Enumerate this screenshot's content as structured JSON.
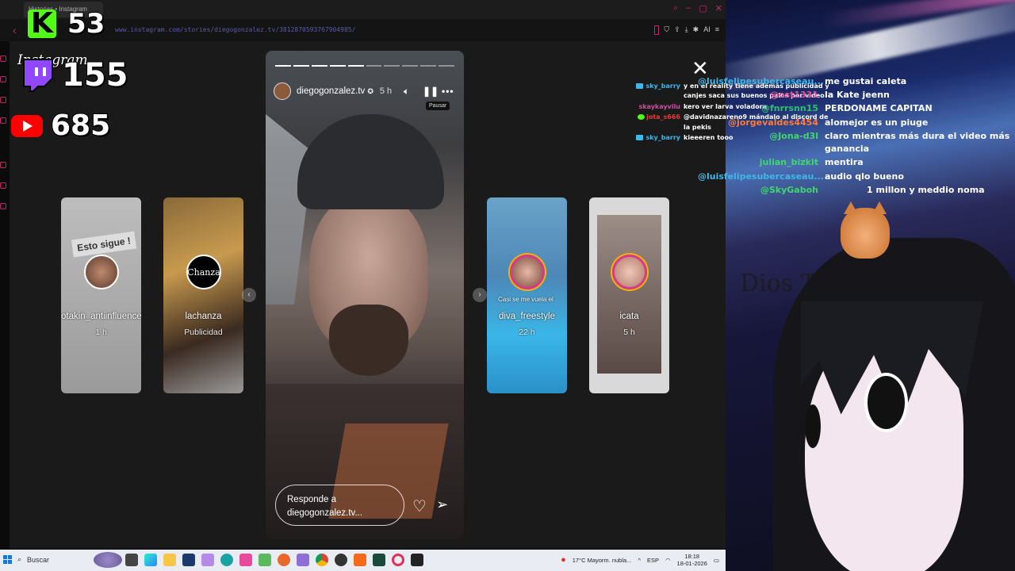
{
  "browser": {
    "tab_title": "Historias • Instagram",
    "url": "www.instagram.com/stories/diegogonzalez.tv/3812870593767904985/",
    "addr_ai": "AI"
  },
  "counters": {
    "kick_logo": "K",
    "kick": "53",
    "instagram_label": "Instagram",
    "twitch": "155",
    "youtube": "685"
  },
  "cards": [
    {
      "name": "otakin_antiinfluencer",
      "sub": "1 h",
      "image_text": "Esto sigue !",
      "sponsor": ""
    },
    {
      "name": "lachanza",
      "sub": "Publicidad",
      "image_text": "",
      "sponsor": "Chanza"
    },
    {
      "name": "diva_freestyle",
      "sub": "22 h",
      "image_text": "Casi se me vuela el",
      "sponsor": ""
    },
    {
      "name": "icata",
      "sub": "5 h",
      "image_text": "",
      "sponsor": ""
    }
  ],
  "story": {
    "username": "diegogonzalez.tv",
    "verified_icon": "verified-badge-icon",
    "time": "5 h",
    "tooltip": "Pausar",
    "reply_placeholder": "Responde a diegogonzalez.tv...",
    "progress_segments": 10,
    "progress_done": 5
  },
  "chat_small": [
    {
      "user": "sky_barry",
      "user_color": "#3fb7e8",
      "msg": "y en el reality tiene además publicidad y",
      "badge": true
    },
    {
      "user": "",
      "user_color": "#ffffff",
      "msg": "canjes saca sus buenos palos por video",
      "badge": false
    },
    {
      "user": "skaykayvilu",
      "user_color": "#d24ea0",
      "msg": "kero ver larva voladora",
      "badge": false
    },
    {
      "user": "jota_s666",
      "user_color": "#e33b3b",
      "msg": "@davidnazareno9 mándalo al discord de",
      "badge": true
    },
    {
      "user": "",
      "user_color": "#ffffff",
      "msg": "la pekis",
      "badge": false
    },
    {
      "user": "sky_barry",
      "user_color": "#3fb7e8",
      "msg": "kieeeren tooo",
      "badge": true
    }
  ],
  "chat_big": [
    {
      "user": "@luisfelipesubercaseau...",
      "user_color": "#3fb7e8",
      "msg": "me gustai caleta"
    },
    {
      "user": "@ost1331",
      "user_color": "#e6529b",
      "msg": "la Kate jeenn"
    },
    {
      "user": "@fnrrsnn15",
      "user_color": "#2fbf71",
      "msg": "PERDONAME CAPITAN"
    },
    {
      "user": "@jorgevaldes4454",
      "user_color": "#ff7a3d",
      "msg": "alomejor es un piuge"
    },
    {
      "user": "@Jona-d3l",
      "user_color": "#3fd66b",
      "msg": "claro mientras más dura el video más"
    },
    {
      "user": "",
      "user_color": "#ffffff",
      "msg": "ganancia"
    },
    {
      "user": "julian_bizkit",
      "user_color": "#3fd66b",
      "msg": "mentira"
    },
    {
      "user": "@luisfelipesubercaseau...",
      "user_color": "#3fb7e8",
      "msg": "audio qlo bueno"
    },
    {
      "user": "@SkyGaboh",
      "user_color": "#3fd66b",
      "msg": "1 millon y meddio noma"
    }
  ],
  "stream_text": "Dios Te A",
  "taskbar": {
    "search": "Buscar",
    "weather": "17°C  Mayorm. nubla...",
    "lang": "ESP",
    "time": "18:18",
    "date": "18-01-2026"
  },
  "colors": {
    "accent": "#c0266a",
    "kick": "#53fc18",
    "twitch": "#9146ff",
    "youtube": "#ff0000"
  }
}
